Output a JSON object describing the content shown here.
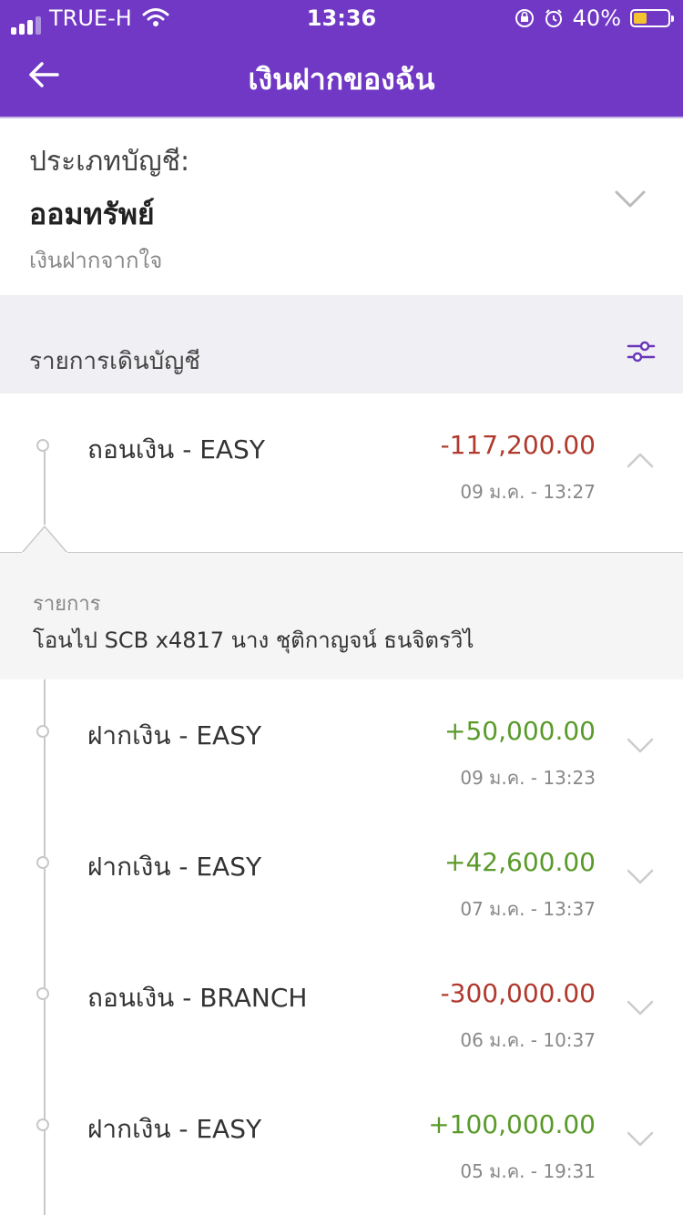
{
  "status_bar": {
    "carrier": "TRUE-H",
    "time": "13:36",
    "battery": "40%",
    "battery_level": 0.4,
    "icons": [
      "signal-icon",
      "wifi-icon",
      "orientation-lock-icon",
      "alarm-icon",
      "battery-icon"
    ]
  },
  "header": {
    "title": "เงินฝากของฉัน",
    "back_icon": "back-arrow-icon"
  },
  "account": {
    "label": "ประเภทบัญชี:",
    "value": "ออมทรัพย์",
    "nickname": "เงินฝากจากใจ"
  },
  "transactions_section": {
    "title": "รายการเดินบัญชี",
    "filter_icon": "filter-sliders-icon"
  },
  "transactions": [
    {
      "title": "ถอนเงิน  - EASY",
      "amount": "-117,200.00",
      "date": "09 ม.ค. - 13:27",
      "type": "debit",
      "expanded": true
    },
    {
      "title": "ฝากเงิน  - EASY",
      "amount": "+50,000.00",
      "date": "09 ม.ค. - 13:23",
      "type": "credit",
      "expanded": false
    },
    {
      "title": "ฝากเงิน  - EASY",
      "amount": "+42,600.00",
      "date": "07 ม.ค. - 13:37",
      "type": "credit",
      "expanded": false
    },
    {
      "title": "ถอนเงิน  - BRANCH",
      "amount": "-300,000.00",
      "date": "06 ม.ค. - 10:37",
      "type": "debit",
      "expanded": false
    },
    {
      "title": "ฝากเงิน  - EASY",
      "amount": "+100,000.00",
      "date": "05 ม.ค. - 19:31",
      "type": "credit",
      "expanded": false
    }
  ],
  "detail": {
    "label": "รายการ",
    "text": "โอนไป SCB x4817 นาง ชุติกาญจน์ ธนจิตรวิไ"
  },
  "colors": {
    "brand": "#7038c4",
    "debit": "#b03a2e",
    "credit": "#5a9a2a",
    "section_bg": "#f0eff3"
  }
}
